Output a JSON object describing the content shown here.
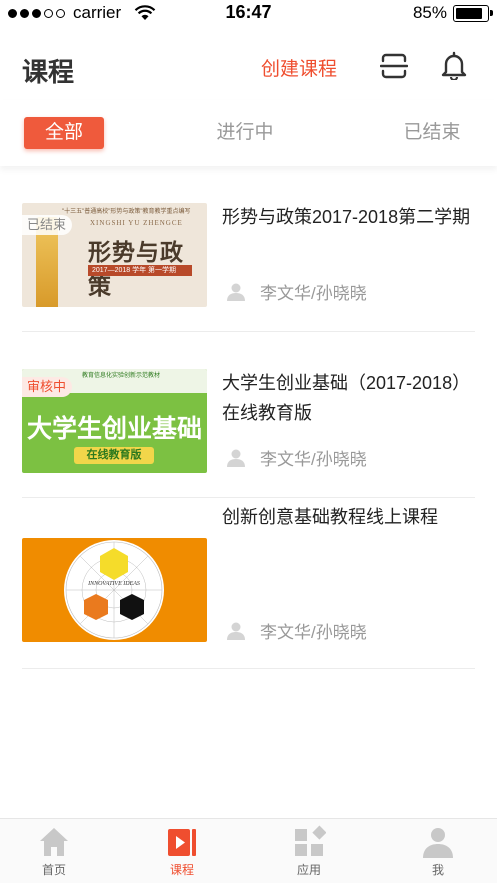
{
  "status_bar": {
    "carrier": "carrier",
    "time": "16:47",
    "battery": "85%",
    "battery_level": 0.85
  },
  "header": {
    "title": "课程",
    "create_label": "创建课程",
    "scan_icon": "scan-icon",
    "bell_icon": "bell-icon"
  },
  "tabs": [
    {
      "label": "全部",
      "active": true
    },
    {
      "label": "进行中",
      "active": false
    },
    {
      "label": "已结束",
      "active": false
    }
  ],
  "courses": [
    {
      "title": "形势与政策2017-2018第二学期",
      "teacher": "李文华/孙晓晓",
      "badge": "已结束",
      "thumb": {
        "headline": "形势与政策",
        "pinyin": "XINGSHI YU ZHENGCE",
        "bar": "2017—2018 学年 第一学期",
        "top": "\"十三五\"普通高校\"形势与政策\"教育教学重点编写"
      }
    },
    {
      "title": "大学生创业基础（2017-2018）在线教育版",
      "teacher": "李文华/孙晓晓",
      "badge": "审核中",
      "thumb": {
        "headline": "大学生创业基础",
        "pill": "在线教育版",
        "top": "教育信息化实验创新示范教材"
      }
    },
    {
      "title": "创新创意基础教程线上课程",
      "teacher": "李文华/孙晓晓",
      "badge": "",
      "thumb": {
        "caption": "INNOVATIVE IDEAS"
      }
    }
  ],
  "tabbar": [
    {
      "label": "首页",
      "icon": "home-icon",
      "active": false
    },
    {
      "label": "课程",
      "icon": "course-icon",
      "active": true
    },
    {
      "label": "应用",
      "icon": "apps-icon",
      "active": false
    },
    {
      "label": "我",
      "icon": "profile-icon",
      "active": false
    }
  ],
  "colors": {
    "accent": "#ef4e2f",
    "tab_active_bg": "#ef5a3c",
    "muted": "#999999"
  }
}
